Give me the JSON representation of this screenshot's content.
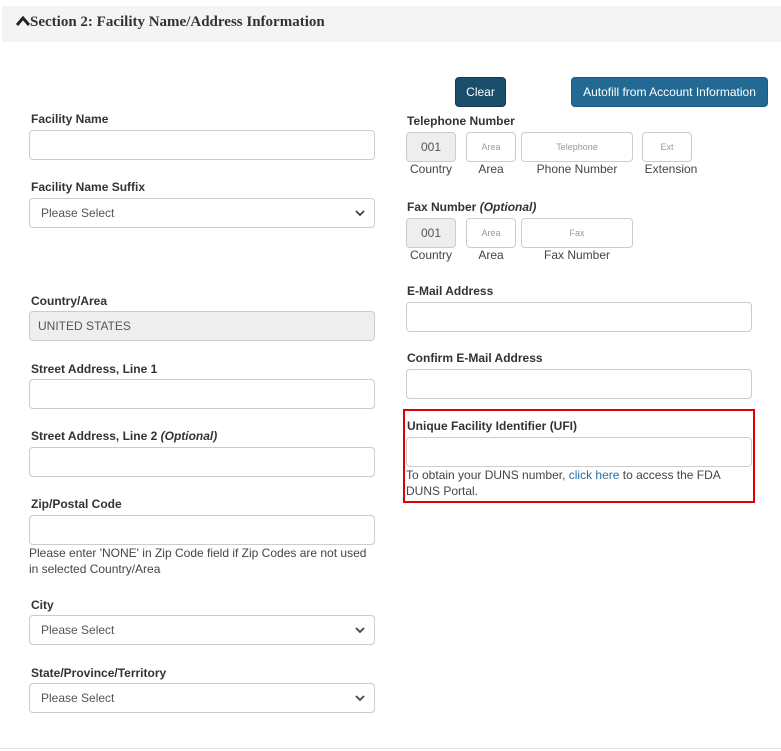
{
  "section": {
    "title": "Section 2: Facility Name/Address Information",
    "toggle_icon": "chevron-up-icon"
  },
  "buttons": {
    "clear": "Clear",
    "autofill": "Autofill from Account Information"
  },
  "left": {
    "facility_name": {
      "label": "Facility Name",
      "value": ""
    },
    "facility_name_suffix": {
      "label": "Facility Name Suffix",
      "selected": "Please Select"
    },
    "country_area": {
      "label": "Country/Area",
      "value": "UNITED STATES"
    },
    "street_1": {
      "label": "Street Address, Line 1",
      "value": ""
    },
    "street_2": {
      "label": "Street Address, Line 2",
      "optional": "(Optional)",
      "value": ""
    },
    "zip": {
      "label": "Zip/Postal Code",
      "value": "",
      "help": "Please enter 'NONE' in Zip Code field if Zip Codes are not used in selected Country/Area"
    },
    "city": {
      "label": "City",
      "selected": "Please Select"
    },
    "state": {
      "label": "State/Province/Territory",
      "selected": "Please Select"
    }
  },
  "right": {
    "telephone": {
      "label": "Telephone Number",
      "country_value": "001",
      "area_placeholder": "Area",
      "phone_placeholder": "Telephone",
      "ext_placeholder": "Ext",
      "sublabels": {
        "country": "Country",
        "area": "Area",
        "phone": "Phone Number",
        "ext": "Extension"
      }
    },
    "fax": {
      "label": "Fax Number",
      "optional": "(Optional)",
      "country_value": "001",
      "area_placeholder": "Area",
      "fax_placeholder": "Fax",
      "sublabels": {
        "country": "Country",
        "area": "Area",
        "fax": "Fax Number"
      }
    },
    "email": {
      "label": "E-Mail Address",
      "value": ""
    },
    "confirm_email": {
      "label": "Confirm E-Mail Address",
      "value": ""
    },
    "ufi": {
      "label": "Unique Facility Identifier (UFI)",
      "value": "",
      "help_before": "To obtain your DUNS number, ",
      "help_link": "click here",
      "help_after": " to access the FDA DUNS Portal."
    }
  },
  "colors": {
    "clear_button": "#1b4e6b",
    "autofill_button": "#226a94",
    "highlight_border": "#e00000",
    "link": "#2a6fa6"
  }
}
